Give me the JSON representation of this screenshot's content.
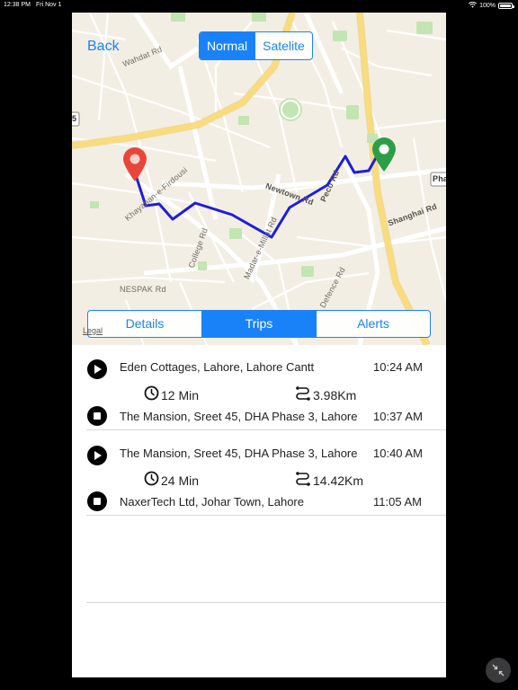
{
  "status_bar": {
    "time": "12:38 PM",
    "date": "Fri Nov 1",
    "battery": "100%",
    "battery_level": 1.0
  },
  "nav": {
    "back_label": "Back"
  },
  "map_type": {
    "options": [
      "Normal",
      "Satelite"
    ],
    "selected": "Normal"
  },
  "map": {
    "labels": {
      "wahdat": "Wahdat Rd",
      "firdousi": "Khayaban-e-Firdousi",
      "newtown": "Newtown Rd",
      "shanghai": "Shanghai Rd",
      "college": "College Rd",
      "madar": "Madar-e-Millat Rd",
      "defence": "Defence Rd",
      "nespak": "NESPAK Rd",
      "pha": "Pha",
      "shield": "5",
      "peco": "Peco Rd"
    },
    "legal": "Legal",
    "route_color": "#1f1ed6",
    "start_pin_color": "#e8463b",
    "end_pin_color": "#2d9d47"
  },
  "tabs": {
    "items": [
      "Details",
      "Trips",
      "Alerts"
    ],
    "selected": "Trips"
  },
  "trips": [
    {
      "start_address": "Eden Cottages, Lahore, Lahore Cantt",
      "start_time": "10:24 AM",
      "duration": "12 Min",
      "distance": "3.98Km",
      "end_address": "The Mansion, Sreet 45, DHA Phase 3, Lahore",
      "end_time": "10:37 AM"
    },
    {
      "start_address": "The Mansion, Sreet 45, DHA Phase 3, Lahore",
      "start_time": "10:40 AM",
      "duration": "24 Min",
      "distance": "14.42Km",
      "end_address": "NaxerTech Ltd, Johar Town, Lahore",
      "end_time": "11:05 AM"
    }
  ],
  "icons": {
    "play": "play-icon",
    "stop": "stop-icon",
    "clock": "clock-icon",
    "route": "route-icon",
    "collapse": "collapse-arrows-icon"
  },
  "colors": {
    "accent": "#1a82f8",
    "map_bg": "#f3eee4",
    "major_road": "#f7d774"
  }
}
